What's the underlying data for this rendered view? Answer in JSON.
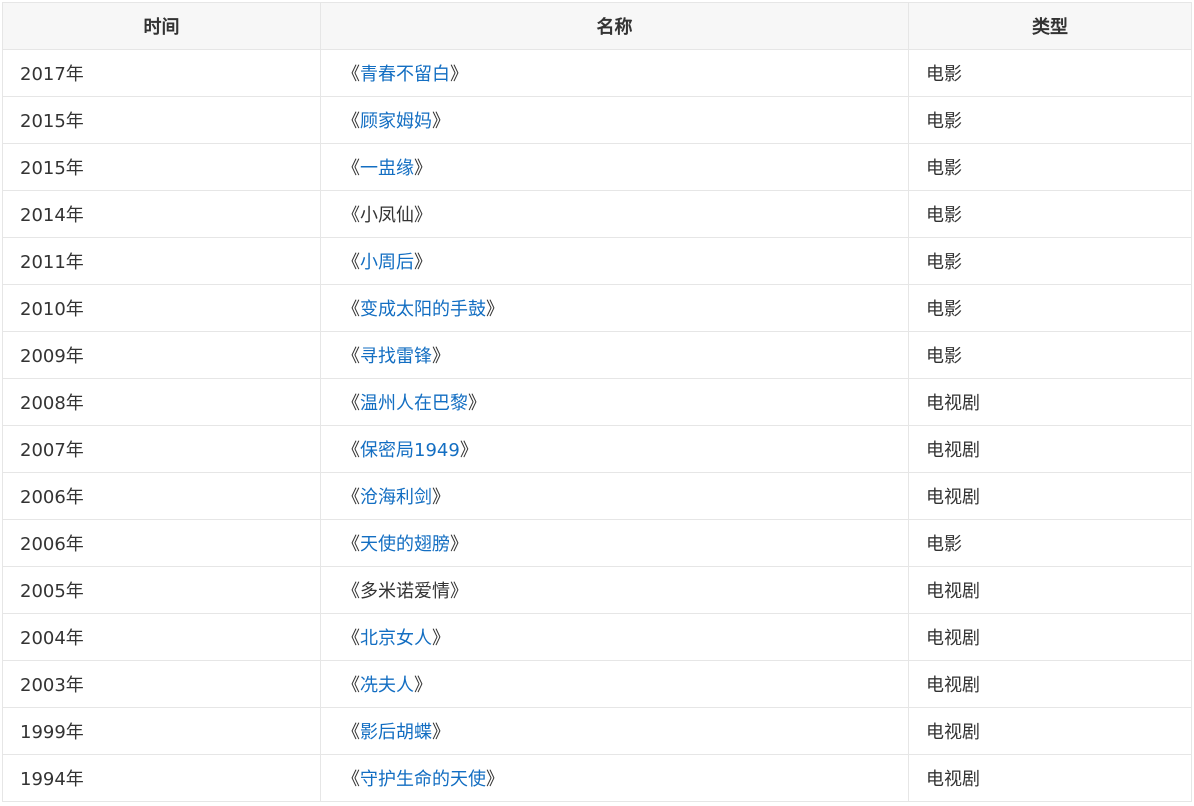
{
  "table": {
    "headers": [
      "时间",
      "名称",
      "类型"
    ],
    "rows": [
      {
        "year": "2017年",
        "title": "青春不留白",
        "type": "电影",
        "linked": true
      },
      {
        "year": "2015年",
        "title": "顾家姆妈",
        "type": "电影",
        "linked": true
      },
      {
        "year": "2015年",
        "title": "一盅缘",
        "type": "电影",
        "linked": true
      },
      {
        "year": "2014年",
        "title": "小凤仙",
        "type": "电影",
        "linked": false
      },
      {
        "year": "2011年",
        "title": "小周后",
        "type": "电影",
        "linked": true
      },
      {
        "year": "2010年",
        "title": "变成太阳的手鼓",
        "type": "电影",
        "linked": true
      },
      {
        "year": "2009年",
        "title": "寻找雷锋",
        "type": "电影",
        "linked": true
      },
      {
        "year": "2008年",
        "title": "温州人在巴黎",
        "type": "电视剧",
        "linked": true
      },
      {
        "year": "2007年",
        "title": "保密局1949",
        "type": "电视剧",
        "linked": true
      },
      {
        "year": "2006年",
        "title": "沧海利剑",
        "type": "电视剧",
        "linked": true
      },
      {
        "year": "2006年",
        "title": "天使的翅膀",
        "type": "电影",
        "linked": true
      },
      {
        "year": "2005年",
        "title": "多米诺爱情",
        "type": "电视剧",
        "linked": false
      },
      {
        "year": "2004年",
        "title": "北京女人",
        "type": "电视剧",
        "linked": true
      },
      {
        "year": "2003年",
        "title": "冼夫人",
        "type": "电视剧",
        "linked": true
      },
      {
        "year": "1999年",
        "title": "影后胡蝶",
        "type": "电视剧",
        "linked": true
      },
      {
        "year": "1994年",
        "title": "守护生命的天使",
        "type": "电视剧",
        "linked": true
      }
    ],
    "open_bracket": "《",
    "close_bracket": "》"
  },
  "colors": {
    "link": "#136ec2",
    "text": "#333333",
    "header_bg": "#f7f7f7",
    "border": "#e6e6e6"
  }
}
